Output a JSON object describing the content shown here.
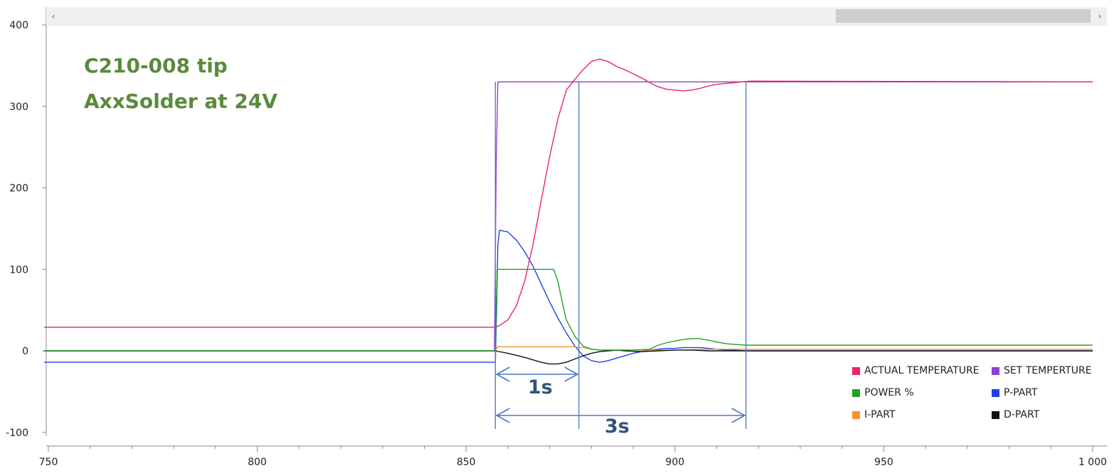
{
  "annotations": {
    "line1": "C210-008 tip",
    "line2": "AxxSolder at 24V",
    "span_1": "1s",
    "span_3": "3s"
  },
  "scrollbar": {
    "left_arrow": "‹",
    "right_arrow": "›"
  },
  "colors": {
    "actual": "#e8236e",
    "set": "#8f3fd6",
    "power": "#1fa32c",
    "ppart": "#2040e8",
    "ipart": "#f0952a",
    "dpart": "#111111",
    "annotation_green": "#5b8a3c",
    "marker_blue": "#4a78c4"
  },
  "chart_data": {
    "type": "line",
    "xlim": [
      749,
      1002
    ],
    "ylim": [
      -100,
      400
    ],
    "x_ticks": [
      750,
      800,
      850,
      900,
      950,
      1000
    ],
    "x_tick_labels": [
      "750",
      "800",
      "850",
      "900",
      "950",
      "1 000"
    ],
    "y_ticks": [
      -100,
      0,
      100,
      200,
      300,
      400
    ],
    "y_tick_labels": [
      "-100",
      "0",
      "100",
      "200",
      "300",
      "400"
    ],
    "grid": false,
    "legend_position": "bottom-right",
    "markers": {
      "vertical_lines_x": [
        857,
        877,
        917
      ],
      "span_1_x": [
        857,
        877
      ],
      "span_3_x": [
        857,
        917
      ]
    },
    "series": [
      {
        "name": "ACTUAL TEMPERATURE",
        "color": "#e8236e",
        "points": [
          [
            749,
            29
          ],
          [
            857,
            29
          ],
          [
            858,
            31
          ],
          [
            860,
            38
          ],
          [
            862,
            55
          ],
          [
            864,
            85
          ],
          [
            866,
            130
          ],
          [
            868,
            185
          ],
          [
            870,
            238
          ],
          [
            872,
            285
          ],
          [
            874,
            320
          ],
          [
            876,
            333
          ],
          [
            878,
            345
          ],
          [
            880,
            355
          ],
          [
            882,
            358
          ],
          [
            884,
            355
          ],
          [
            886,
            349
          ],
          [
            888,
            345
          ],
          [
            890,
            340
          ],
          [
            892,
            335
          ],
          [
            894,
            329
          ],
          [
            896,
            324
          ],
          [
            898,
            321
          ],
          [
            900,
            320
          ],
          [
            902,
            319
          ],
          [
            904,
            320
          ],
          [
            906,
            322
          ],
          [
            908,
            325
          ],
          [
            910,
            327
          ],
          [
            912,
            328
          ],
          [
            914,
            329
          ],
          [
            916,
            330
          ],
          [
            918,
            331
          ],
          [
            1000,
            330
          ]
        ]
      },
      {
        "name": "SET TEMPERTURE",
        "color": "#8f3fd6",
        "points": [
          [
            749,
            0
          ],
          [
            856.8,
            0
          ],
          [
            857.2,
            230
          ],
          [
            857.6,
            330
          ],
          [
            1000,
            330
          ]
        ]
      },
      {
        "name": "POWER %",
        "color": "#1fa32c",
        "points": [
          [
            749,
            0
          ],
          [
            857,
            0
          ],
          [
            857.4,
            100
          ],
          [
            870,
            100
          ],
          [
            871,
            100
          ],
          [
            872,
            85
          ],
          [
            873,
            60
          ],
          [
            874,
            38
          ],
          [
            876,
            18
          ],
          [
            878,
            6
          ],
          [
            880,
            2
          ],
          [
            882,
            1
          ],
          [
            886,
            1
          ],
          [
            890,
            1
          ],
          [
            894,
            2
          ],
          [
            896,
            7
          ],
          [
            898,
            10
          ],
          [
            900,
            12
          ],
          [
            902,
            14
          ],
          [
            904,
            15
          ],
          [
            906,
            15
          ],
          [
            908,
            13
          ],
          [
            910,
            11
          ],
          [
            912,
            9
          ],
          [
            914,
            8
          ],
          [
            917,
            7
          ],
          [
            1000,
            7
          ]
        ]
      },
      {
        "name": "P-PART",
        "color": "#2040e8",
        "points": [
          [
            749,
            -14
          ],
          [
            857,
            -14
          ],
          [
            857.3,
            50
          ],
          [
            857.6,
            130
          ],
          [
            858,
            148
          ],
          [
            860,
            146
          ],
          [
            862,
            136
          ],
          [
            864,
            122
          ],
          [
            866,
            104
          ],
          [
            868,
            82
          ],
          [
            870,
            60
          ],
          [
            872,
            40
          ],
          [
            874,
            22
          ],
          [
            876,
            6
          ],
          [
            878,
            -6
          ],
          [
            880,
            -12
          ],
          [
            882,
            -14
          ],
          [
            884,
            -12
          ],
          [
            886,
            -9
          ],
          [
            888,
            -6
          ],
          [
            890,
            -3
          ],
          [
            892,
            -1
          ],
          [
            894,
            1
          ],
          [
            896,
            2
          ],
          [
            898,
            3
          ],
          [
            900,
            3
          ],
          [
            902,
            4
          ],
          [
            904,
            4
          ],
          [
            906,
            4
          ],
          [
            908,
            3
          ],
          [
            910,
            2
          ],
          [
            912,
            1
          ],
          [
            914,
            1
          ],
          [
            917,
            0
          ],
          [
            1000,
            0
          ]
        ]
      },
      {
        "name": "I-PART",
        "color": "#f0952a",
        "points": [
          [
            749,
            0
          ],
          [
            857,
            0
          ],
          [
            857.5,
            5
          ],
          [
            874,
            5
          ],
          [
            876,
            5
          ],
          [
            878,
            4
          ],
          [
            880,
            2
          ],
          [
            883,
            1
          ],
          [
            888,
            1
          ],
          [
            900,
            1
          ],
          [
            910,
            2
          ],
          [
            917,
            2
          ],
          [
            1000,
            2
          ]
        ]
      },
      {
        "name": "D-PART",
        "color": "#111111",
        "points": [
          [
            749,
            0
          ],
          [
            857,
            0
          ],
          [
            860,
            -3
          ],
          [
            864,
            -8
          ],
          [
            868,
            -14
          ],
          [
            870,
            -16
          ],
          [
            872,
            -16
          ],
          [
            874,
            -14
          ],
          [
            876,
            -10
          ],
          [
            878,
            -6
          ],
          [
            880,
            -3
          ],
          [
            882,
            -1
          ],
          [
            884,
            0
          ],
          [
            886,
            1
          ],
          [
            888,
            0
          ],
          [
            892,
            -1
          ],
          [
            896,
            0
          ],
          [
            900,
            1
          ],
          [
            904,
            1
          ],
          [
            908,
            0
          ],
          [
            917,
            0
          ],
          [
            1000,
            0
          ]
        ]
      }
    ]
  }
}
